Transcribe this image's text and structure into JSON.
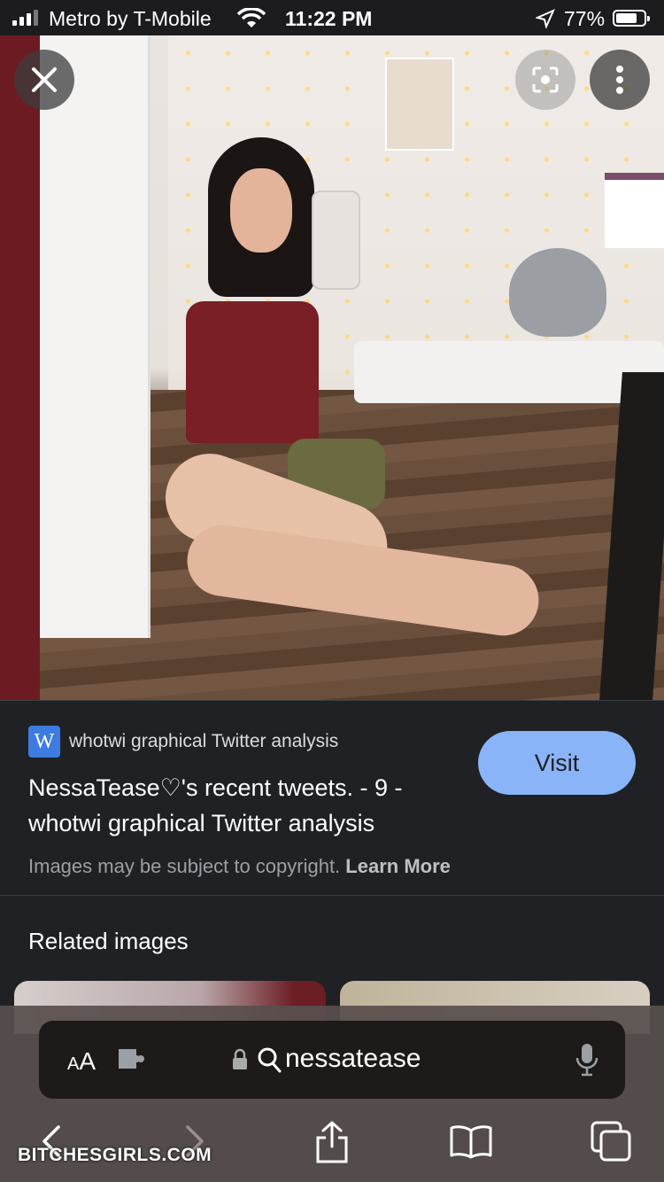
{
  "status_bar": {
    "carrier": "Metro by T-Mobile",
    "time": "11:22 PM",
    "battery_pct": "77%",
    "battery_level": 0.77
  },
  "photo": {
    "icons": [
      "close-icon",
      "lens-icon",
      "more-vert-icon"
    ]
  },
  "result": {
    "favicon_letter": "W",
    "source": "whotwi graphical Twitter analysis",
    "title": "NessaTease♡'s recent tweets. - 9 - whotwi graphical Twitter analysis",
    "visit_label": "Visit",
    "copyright_text": "Images may be subject to copyright.",
    "learn_more": "Learn More"
  },
  "related": {
    "title": "Related images"
  },
  "browser": {
    "aa_small": "A",
    "aa_big": "A",
    "url": "nessatease"
  },
  "watermark": "BITCHESGIRLS.COM",
  "colors": {
    "accent": "#8ab4f8",
    "background": "#202124",
    "favicon": "#3d7be0"
  }
}
